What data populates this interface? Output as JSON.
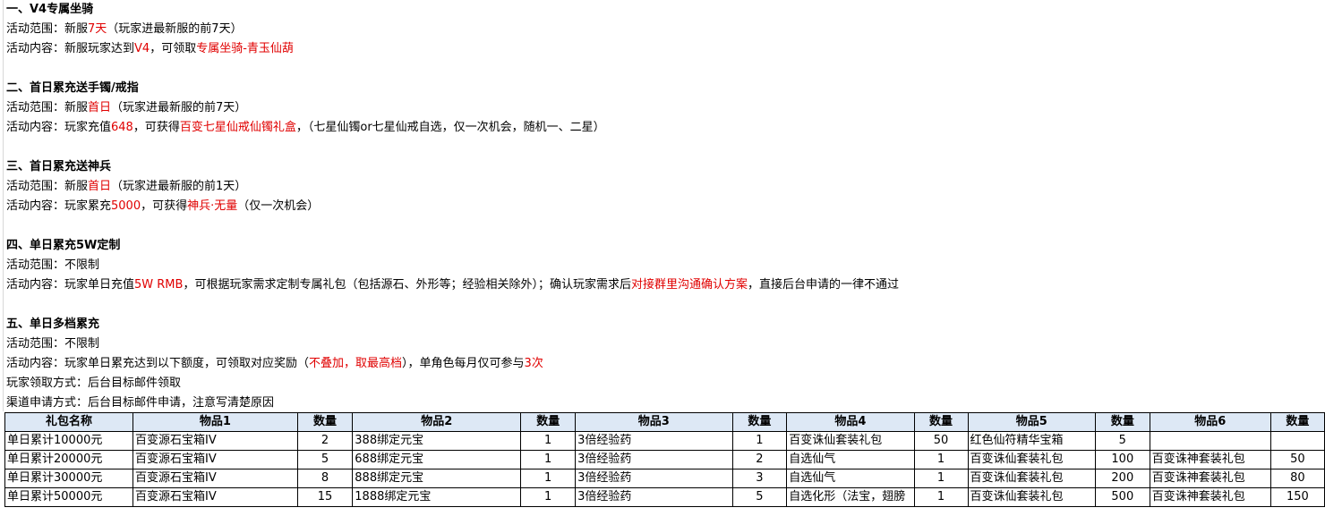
{
  "sections": [
    {
      "title": "一、V4专属坐骑",
      "lines": [
        [
          "活动范围：新服",
          {
            "t": "7天",
            "red": true
          },
          "（玩家进最新服的前7天）"
        ],
        [
          "活动内容：新服玩家达到",
          {
            "t": "V4",
            "red": true
          },
          "，可领取",
          {
            "t": "专属坐骑-青玉仙葫",
            "red": true
          }
        ]
      ]
    },
    {
      "title": "二、首日累充送手镯/戒指",
      "lines": [
        [
          "活动范围：新服",
          {
            "t": "首日",
            "red": true
          },
          "（玩家进最新服的前7天）"
        ],
        [
          "活动内容：玩家充值",
          {
            "t": "648",
            "red": true
          },
          "，可获得",
          {
            "t": "百变七星仙戒仙镯礼盒",
            "red": true
          },
          "，（七星仙镯or七星仙戒自选，仅一次机会，随机一、二星）"
        ]
      ]
    },
    {
      "title": "三、首日累充送神兵",
      "lines": [
        [
          "活动范围：新服",
          {
            "t": "首日",
            "red": true
          },
          "（玩家进最新服的前1天）"
        ],
        [
          "活动内容：玩家累充",
          {
            "t": "5000",
            "red": true
          },
          "，可获得",
          {
            "t": "神兵·无量",
            "red": true
          },
          "（仅一次机会）"
        ]
      ]
    },
    {
      "title": "四、单日累充5W定制",
      "lines": [
        [
          "活动范围：不限制"
        ],
        [
          "活动内容：玩家单日充值",
          {
            "t": "5W RMB",
            "red": true
          },
          "，可根据玩家需求定制专属礼包（包括源石、外形等；经验相关除外）；确认玩家需求后",
          {
            "t": "对接群里沟通确认方案",
            "red": true
          },
          "，直接后台申请的一律不通过"
        ]
      ]
    },
    {
      "title": "五、单日多档累充",
      "lines": [
        [
          "活动范围：不限制"
        ],
        [
          "活动内容：玩家单日累充达到以下额度，可领取对应奖励（",
          {
            "t": "不叠加，取最高档",
            "red": true
          },
          "），单角色每月仅可参与",
          {
            "t": "3次",
            "red": true
          }
        ],
        [
          "玩家领取方式：后台目标邮件领取"
        ],
        [
          "渠道申请方式：后台目标邮件申请，注意写清楚原因"
        ]
      ]
    }
  ],
  "table": {
    "headers": [
      "礼包名称",
      "物品1",
      "数量",
      "物品2",
      "数量",
      "物品3",
      "数量",
      "物品4",
      "数量",
      "物品5",
      "数量",
      "物品6",
      "数量"
    ],
    "rows": [
      [
        "单日累计10000元",
        "百变源石宝箱IV",
        "2",
        "388绑定元宝",
        "1",
        "3倍经验药",
        "1",
        "百变诛仙套装礼包",
        "50",
        "红色仙符精华宝箱",
        "5",
        "",
        ""
      ],
      [
        "单日累计20000元",
        "百变源石宝箱IV",
        "5",
        "688绑定元宝",
        "1",
        "3倍经验药",
        "2",
        "自选仙气",
        "1",
        "百变诛仙套装礼包",
        "100",
        "百变诛神套装礼包",
        "50"
      ],
      [
        "单日累计30000元",
        "百变源石宝箱IV",
        "8",
        "888绑定元宝",
        "1",
        "3倍经验药",
        "3",
        "自选仙气",
        "1",
        "百变诛仙套装礼包",
        "200",
        "百变诛神套装礼包",
        "80"
      ],
      [
        "单日累计50000元",
        "百变源石宝箱IV",
        "15",
        "1888绑定元宝",
        "1",
        "3倍经验药",
        "5",
        "自选化形（法宝，翅膀",
        "1",
        "百变诛仙套装礼包",
        "500",
        "百变诛神套装礼包",
        "150"
      ]
    ]
  },
  "colors": {
    "highlight": "#e00000",
    "header_bg": "#dde8f5"
  }
}
